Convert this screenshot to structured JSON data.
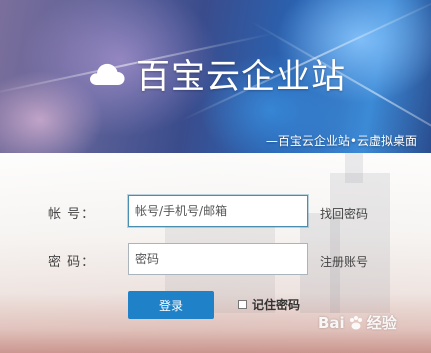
{
  "header": {
    "logo_icon": "cloud-icon",
    "title": "百宝云企业站",
    "slogan": "—百宝云企业站•云虚拟桌面"
  },
  "form": {
    "account_label": "帐  号：",
    "account_placeholder": "帐号/手机号/邮箱",
    "password_label": "密  码：",
    "password_placeholder": "密码",
    "forgot_password_link": "找回密码",
    "register_link": "注册账号",
    "login_button": "登录",
    "remember_label": "记住密码"
  },
  "watermark": {
    "brand_prefix": "Bai",
    "brand_suffix": "经验",
    "icon": "baidu-paw-icon"
  },
  "colors": {
    "primary_button": "#1f82c8",
    "active_input_border": "#4a8fb0"
  }
}
